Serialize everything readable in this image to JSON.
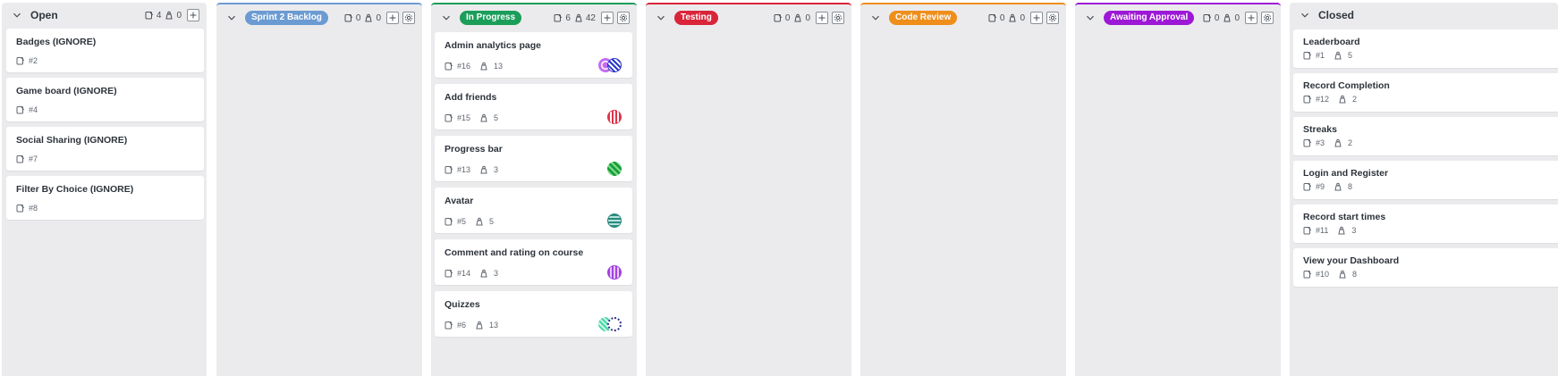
{
  "columns": {
    "open": {
      "title": "Open",
      "issues": "4",
      "points": "0",
      "cards": [
        {
          "title": "Badges (IGNORE)",
          "number": "#2"
        },
        {
          "title": "Game board (IGNORE)",
          "number": "#4"
        },
        {
          "title": "Social Sharing (IGNORE)",
          "number": "#7"
        },
        {
          "title": "Filter By Choice (IGNORE)",
          "number": "#8"
        }
      ]
    },
    "sprint2": {
      "title": "Sprint 2 Backlog",
      "issues": "0",
      "points": "0",
      "color": "#6b9bd2"
    },
    "inprogress": {
      "title": "In Progress",
      "issues": "6",
      "points": "42",
      "color": "#1a9e5a",
      "cards": [
        {
          "title": "Admin analytics page",
          "number": "#16",
          "points": "13"
        },
        {
          "title": "Add friends",
          "number": "#15",
          "points": "5"
        },
        {
          "title": "Progress bar",
          "number": "#13",
          "points": "3"
        },
        {
          "title": "Avatar",
          "number": "#5",
          "points": "5"
        },
        {
          "title": "Comment and rating on course",
          "number": "#14",
          "points": "3"
        },
        {
          "title": "Quizzes",
          "number": "#6",
          "points": "13"
        }
      ]
    },
    "testing": {
      "title": "Testing",
      "issues": "0",
      "points": "0",
      "color": "#d9243a"
    },
    "codereview": {
      "title": "Code Review",
      "issues": "0",
      "points": "0",
      "color": "#ef8e1b"
    },
    "awaiting": {
      "title": "Awaiting Approval",
      "issues": "0",
      "points": "0",
      "color": "#9d18d6"
    },
    "closed": {
      "title": "Closed",
      "cards": [
        {
          "title": "Leaderboard",
          "number": "#1",
          "points": "5"
        },
        {
          "title": "Record Completion",
          "number": "#12",
          "points": "2"
        },
        {
          "title": "Streaks",
          "number": "#3",
          "points": "2"
        },
        {
          "title": "Login and Register",
          "number": "#9",
          "points": "8"
        },
        {
          "title": "Record start times",
          "number": "#11",
          "points": "3"
        },
        {
          "title": "View your Dashboard",
          "number": "#10",
          "points": "8"
        }
      ]
    }
  },
  "icons": {
    "collapse": "chevron-down-icon",
    "issue": "issue-icon",
    "points": "weight-icon",
    "add": "plus-icon",
    "settings": "gear-icon",
    "avatar": "identicon-avatar"
  }
}
